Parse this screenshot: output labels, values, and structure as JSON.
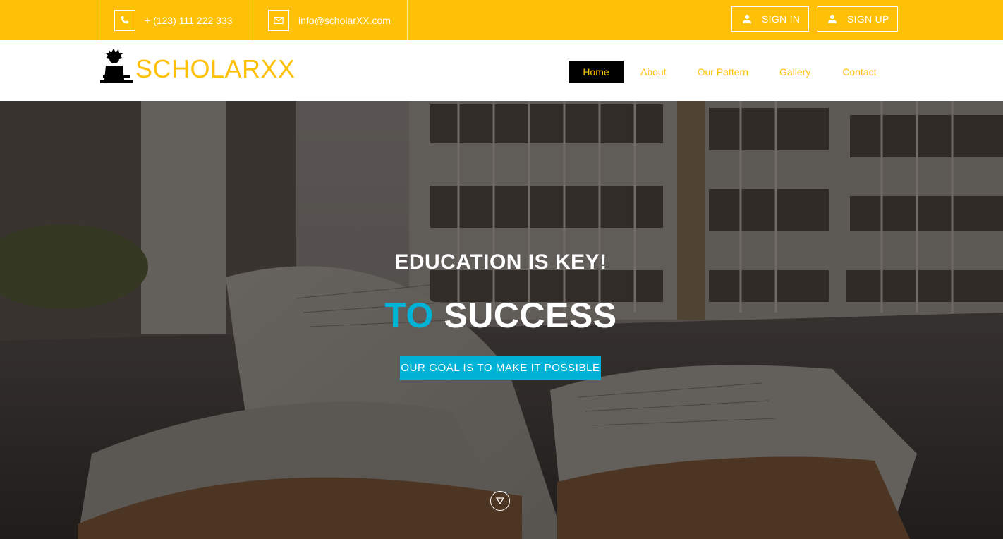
{
  "topbar": {
    "phone": "+ (123) 111 222 333",
    "email": "info@scholarXX.com",
    "signin_label": "SIGN IN",
    "signup_label": "SIGN UP"
  },
  "header": {
    "logo_text": "SCHOLARXX",
    "nav": [
      {
        "label": "Home",
        "active": true
      },
      {
        "label": "About"
      },
      {
        "label": "Our Pattern"
      },
      {
        "label": "Gallery"
      },
      {
        "label": "Contact"
      }
    ]
  },
  "hero": {
    "title": "EDUCATION IS KEY!",
    "subtitle_accent": "TO",
    "subtitle_rest": "SUCCESS",
    "cta_label": "OUR GOAL IS TO MAKE IT POSSIBLE"
  },
  "colors": {
    "brand_yellow": "#ffc107",
    "accent_cyan": "#00b2d6",
    "nav_active_bg": "#000000"
  },
  "icons": {
    "phone": "phone-icon",
    "email": "envelope-icon",
    "user": "user-icon",
    "scroll": "chevron-down-circle-icon"
  }
}
